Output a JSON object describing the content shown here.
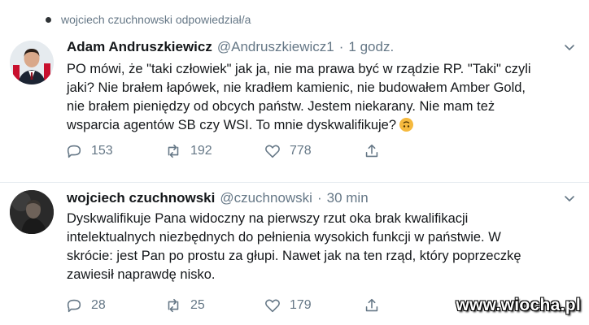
{
  "retweet_context": {
    "icon": "dot-icon",
    "text": "wojciech czuchnowski odpowiedział/a"
  },
  "tweets": [
    {
      "author_name": "Adam Andruszkiewicz",
      "handle": "@Andruszkiewicz1",
      "separator": "·",
      "time": "1 godz.",
      "lines": [
        "PO mówi, że \"taki człowiek\" jak ja, nie ma prawa być w rządzie RP. \"Taki\" czyli",
        "jaki? Nie brałem łapówek, nie kradłem kamienic, nie budowałem Amber Gold,",
        "nie brałem pieniędzy od obcych państw. Jestem niekarany. Nie mam też",
        "wsparcia agentów SB czy WSI. To mnie dyskwalifikuje?"
      ],
      "emoji": "upside-down-face-emoji",
      "replies": "153",
      "retweets": "192",
      "likes": "778"
    },
    {
      "author_name": "wojciech czuchnowski",
      "handle": "@czuchnowski",
      "separator": "·",
      "time": "30 min",
      "lines": [
        "Dyskwalifikuje Pana widoczny na pierwszy rzut oka  brak kwalifikacji",
        "intelektualnych niezbędnych do pełnienia wysokich funkcji w państwie. W",
        "skrócie: jest Pan po prostu za głupi. Nawet jak na ten rząd, który poprzeczkę",
        "zawiesił naprawdę nisko."
      ],
      "replies": "28",
      "retweets": "25",
      "likes": "179"
    }
  ],
  "watermark": "www.wiocha.pl",
  "colors": {
    "text": "#14171a",
    "secondary": "#657786",
    "divider": "#e6ecf0",
    "emoji": "#f5b93e"
  }
}
